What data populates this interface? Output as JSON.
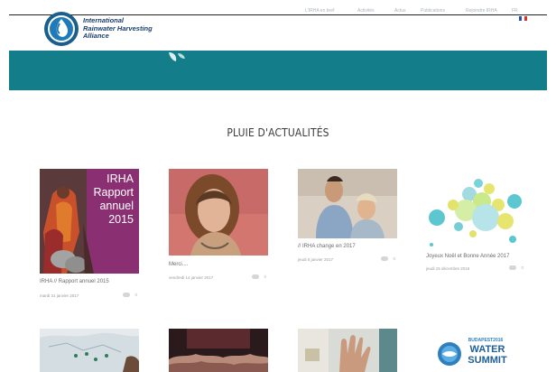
{
  "header": {
    "logo_lines": [
      "International",
      "Rainwater Harvesting",
      "Alliance"
    ],
    "nav": [
      "L'IRHA en bref",
      "Activités",
      "Actus",
      "Publications",
      "Rejoindre IRHA",
      "FR"
    ]
  },
  "section_title": "PLUIE D'ACTUALITÉS",
  "cards": [
    {
      "title": "IRHA // Rapport annuel 2015",
      "date": "mardi 31 janvier 2017",
      "comments": "0",
      "overlay_lines": [
        "IRHA",
        "Rapport",
        "annuel",
        "2015"
      ]
    },
    {
      "title": "Merci....",
      "date": "vendredi 14 janvier 2017",
      "comments": "0"
    },
    {
      "title": "// IRHA change en 2017",
      "date": "jeudi 5 janvier 2017",
      "comments": "0"
    },
    {
      "title": "Joyeux Noël et Bonne Année 2017",
      "date": "jeudi 15 décembre 2016",
      "comments": "0"
    }
  ],
  "summit_badge": {
    "top": "BUDAPEST2016",
    "line1": "WATER",
    "line2": "SUMMIT"
  },
  "colors": {
    "banner": "#137e89",
    "logo_text": "#1b3f6d",
    "annual_bg": "#8b2f73"
  }
}
